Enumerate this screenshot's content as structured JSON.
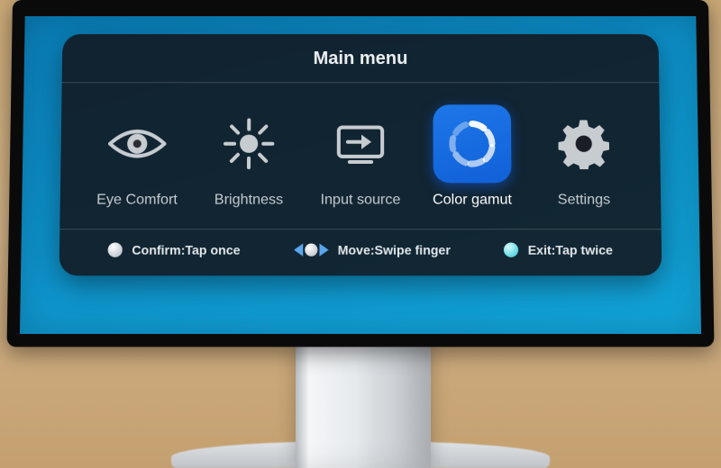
{
  "title": "Main menu",
  "menu": {
    "items": [
      {
        "id": "eye-comfort",
        "label": "Eye Comfort",
        "icon": "eye-icon",
        "selected": false
      },
      {
        "id": "brightness",
        "label": "Brightness",
        "icon": "brightness-icon",
        "selected": false
      },
      {
        "id": "input-source",
        "label": "Input source",
        "icon": "input-source-icon",
        "selected": false
      },
      {
        "id": "color-gamut",
        "label": "Color gamut",
        "icon": "color-gamut-icon",
        "selected": true
      },
      {
        "id": "settings",
        "label": "Settings",
        "icon": "gear-icon",
        "selected": false
      }
    ]
  },
  "hints": {
    "confirm": "Confirm:Tap once",
    "move": "Move:Swipe finger",
    "exit": "Exit:Tap twice"
  },
  "colors": {
    "accent": "#1566e0",
    "panel": "rgba(18,22,28,.88)"
  }
}
